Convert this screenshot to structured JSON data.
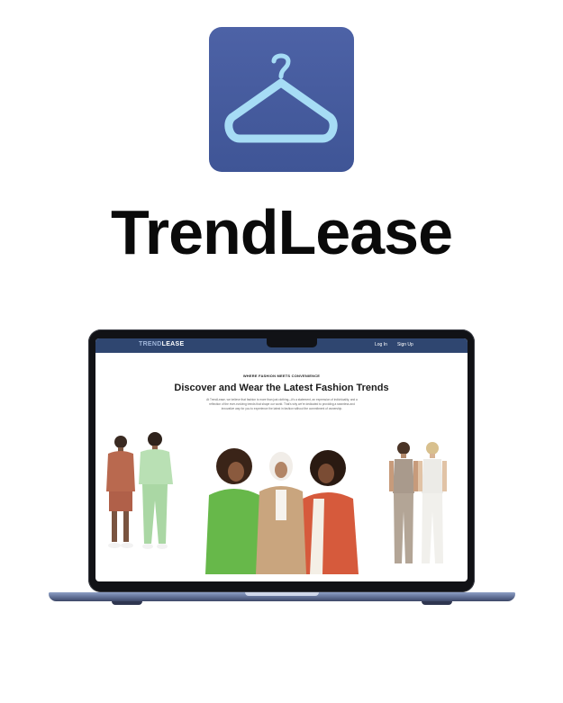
{
  "brand": {
    "title": "TrendLease",
    "icon": "hanger-icon",
    "icon_bg_color": "#4a5fa3",
    "icon_fg_color": "#a6dcf5"
  },
  "website": {
    "logo_part1": "TREND",
    "logo_part2": "LEASE",
    "nav": {
      "login": "Log In",
      "signup": "Sign Up"
    },
    "header_color": "#2f4670",
    "eyebrow": "WHERE FASHION MEETS CONVENIENCE",
    "hero_title": "Discover and Wear the Latest Fashion Trends",
    "hero_body": "At TrendLease, we believe that fashion is more than just clothing—it's a statement, an expression of individuality, and a reflection of the ever-evolving trends that shape our world. That's why we're dedicated to providing a seamless and innovative way for you to experience the latest in fashion without the commitment of ownership."
  }
}
